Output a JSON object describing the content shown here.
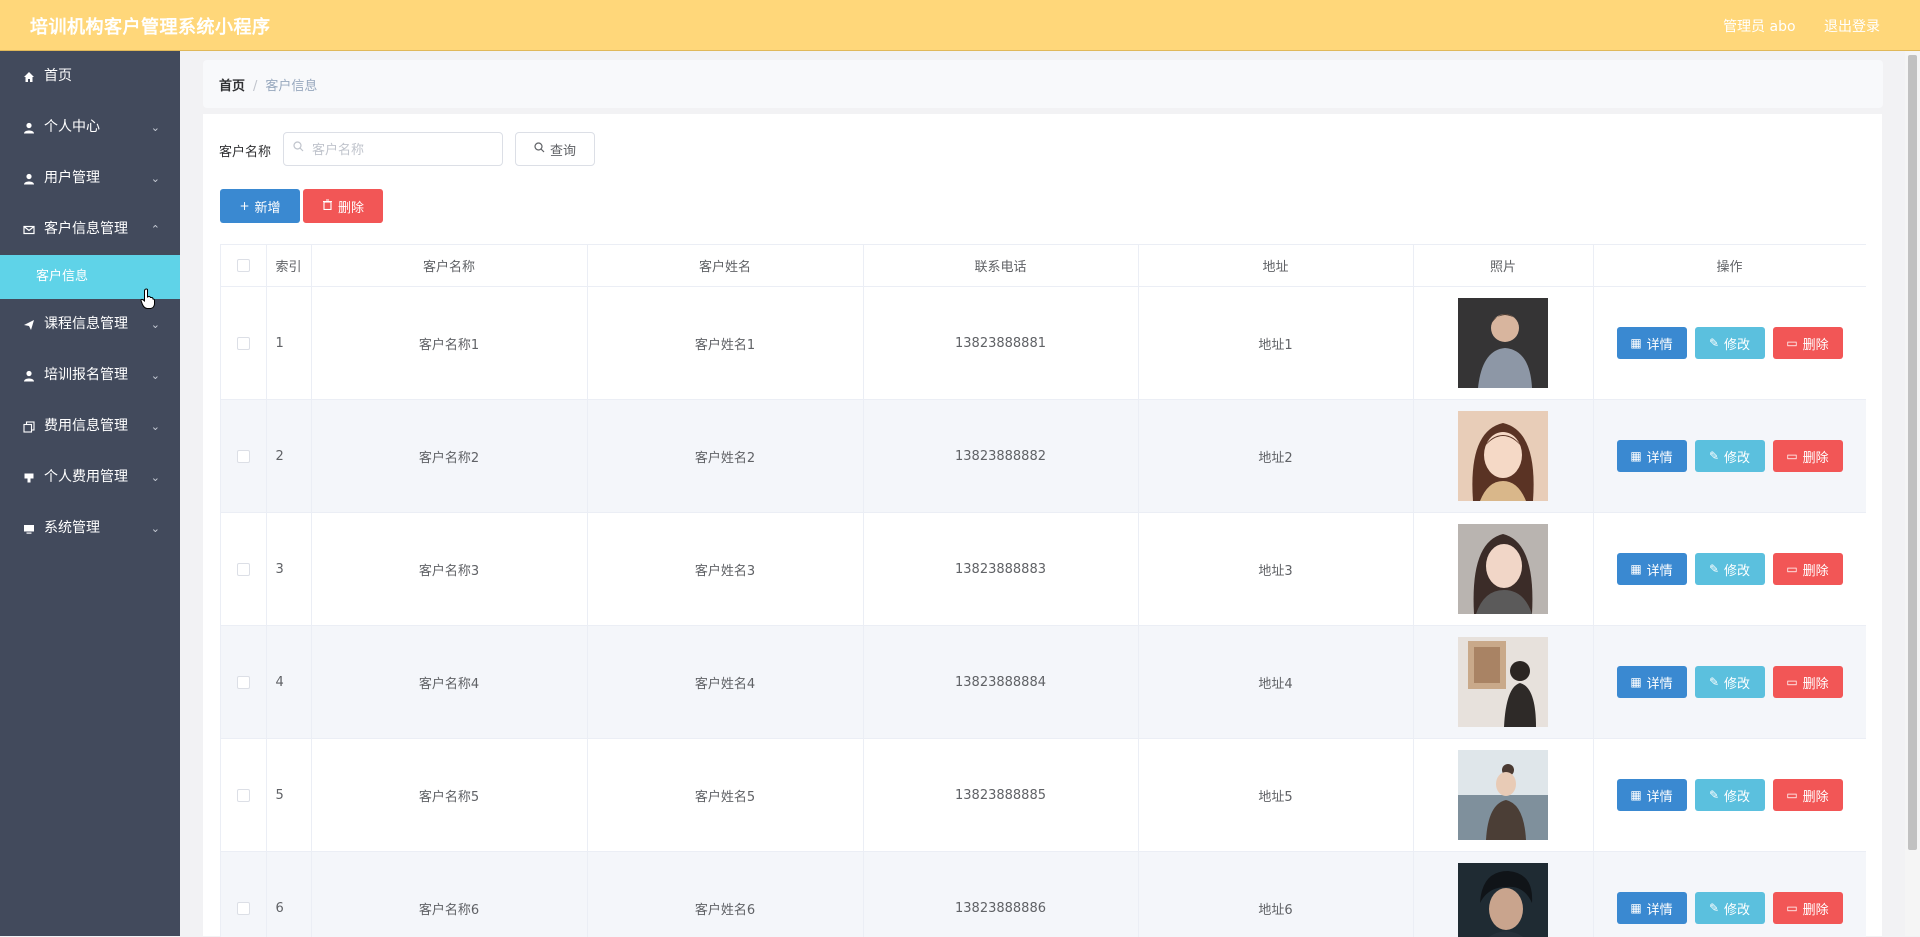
{
  "header": {
    "title": "培训机构客户管理系统小程序",
    "user_label": "管理员 abo",
    "logout_label": "退出登录"
  },
  "sidebar": {
    "items": [
      {
        "label": "首页",
        "icon": "home-icon",
        "has_children": false
      },
      {
        "label": "个人中心",
        "icon": "user-icon",
        "has_children": true
      },
      {
        "label": "用户管理",
        "icon": "user-icon",
        "has_children": true
      },
      {
        "label": "客户信息管理",
        "icon": "mail-icon",
        "has_children": true,
        "expanded": true
      },
      {
        "label": "课程信息管理",
        "icon": "send-icon",
        "has_children": true
      },
      {
        "label": "培训报名管理",
        "icon": "user-icon",
        "has_children": true
      },
      {
        "label": "费用信息管理",
        "icon": "copy-icon",
        "has_children": true
      },
      {
        "label": "个人费用管理",
        "icon": "coffee-icon",
        "has_children": true
      },
      {
        "label": "系统管理",
        "icon": "monitor-icon",
        "has_children": true
      }
    ],
    "active_sub": "客户信息"
  },
  "breadcrumb": {
    "home": "首页",
    "separator": "/",
    "current": "客户信息"
  },
  "search": {
    "label": "客户名称",
    "placeholder": "客户名称",
    "value": "",
    "query_label": "查询"
  },
  "toolbar": {
    "add_label": "新增",
    "delete_label": "删除"
  },
  "table": {
    "columns": [
      "索引",
      "客户名称",
      "客户姓名",
      "联系电话",
      "地址",
      "照片",
      "操作"
    ],
    "rows": [
      {
        "index": "1",
        "name": "客户名称1",
        "person": "客户姓名1",
        "phone": "13823888881",
        "address": "地址1"
      },
      {
        "index": "2",
        "name": "客户名称2",
        "person": "客户姓名2",
        "phone": "13823888882",
        "address": "地址2"
      },
      {
        "index": "3",
        "name": "客户名称3",
        "person": "客户姓名3",
        "phone": "13823888883",
        "address": "地址3"
      },
      {
        "index": "4",
        "name": "客户名称4",
        "person": "客户姓名4",
        "phone": "13823888884",
        "address": "地址4"
      },
      {
        "index": "5",
        "name": "客户名称5",
        "person": "客户姓名5",
        "phone": "13823888885",
        "address": "地址5"
      },
      {
        "index": "6",
        "name": "客户名称6",
        "person": "客户姓名6",
        "phone": "13823888886",
        "address": "地址6"
      }
    ],
    "actions": {
      "detail": "详情",
      "edit": "修改",
      "delete": "删除"
    }
  },
  "colors": {
    "header_bg": "#ffd77a",
    "sidebar_bg": "#424a5c",
    "active_sub_bg": "#5fd3e8",
    "primary": "#3a89d1",
    "info": "#5bc0de",
    "danger": "#f25656"
  }
}
